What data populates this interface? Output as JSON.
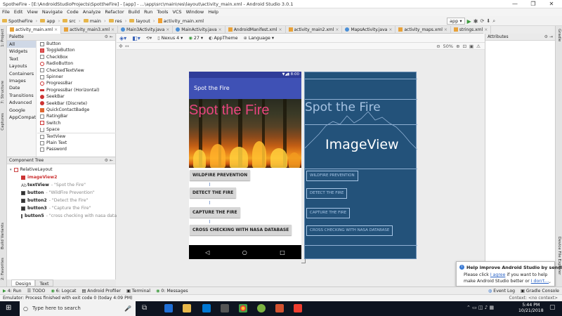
{
  "window": {
    "title": "SpotheFire - [E:\\AndroidStudioProjects\\SpottheFire] - [app] - ...\\app\\src\\main\\res\\layout\\activity_main.xml - Android Studio 3.0.1",
    "min_glyph": "—",
    "max_glyph": "❐",
    "close_glyph": "✕"
  },
  "menu": [
    "File",
    "Edit",
    "View",
    "Navigate",
    "Code",
    "Analyze",
    "Refactor",
    "Build",
    "Run",
    "Tools",
    "VCS",
    "Window",
    "Help"
  ],
  "breadcrumbs": [
    "SpotheFire",
    "app",
    "src",
    "main",
    "res",
    "layout",
    "activity_main.xml"
  ],
  "run_config": "app",
  "tabs": [
    {
      "label": "activity_main.xml",
      "type": "xml",
      "active": true
    },
    {
      "label": "activity_main3.xml",
      "type": "xml"
    },
    {
      "label": "Main3Activity.java",
      "type": "java"
    },
    {
      "label": "MainActivity.java",
      "type": "java"
    },
    {
      "label": "AndroidManifest.xml",
      "type": "xml"
    },
    {
      "label": "activity_main2.xml",
      "type": "xml"
    },
    {
      "label": "MapsActivity.java",
      "type": "java"
    },
    {
      "label": "activity_maps.xml",
      "type": "xml"
    },
    {
      "label": "strings.xml",
      "type": "xml"
    }
  ],
  "left_strip": [
    "1: Project",
    "7: Structure",
    "Captures",
    "Build Variants",
    "2: Favorites"
  ],
  "right_strip": [
    "Gradle",
    "Device File Explorer"
  ],
  "palette": {
    "title": "Palette",
    "categories": [
      "All",
      "Widgets",
      "Text",
      "Layouts",
      "Containers",
      "Images",
      "Date",
      "Transitions",
      "Advanced",
      "Google",
      "AppCompat"
    ],
    "selected_category": "All",
    "widgets": [
      "Button",
      "ToggleButton",
      "CheckBox",
      "RadioButton",
      "CheckedTextView",
      "Spinner",
      "ProgressBar",
      "ProgressBar (Horizontal)",
      "SeekBar",
      "SeekBar (Discrete)",
      "QuickContactBadge",
      "RatingBar",
      "Switch",
      "Space",
      "TextView",
      "Plain Text",
      "Password"
    ]
  },
  "component_tree": {
    "title": "Component Tree",
    "root": "RelativeLayout",
    "items": [
      {
        "id": "imageView2",
        "hint": "",
        "error": true
      },
      {
        "id": "textView",
        "hint": "- \"Spot the Fire\""
      },
      {
        "id": "button",
        "hint": "- \"WildFire Prevention\""
      },
      {
        "id": "button2",
        "hint": "- \"Detect the Fire\""
      },
      {
        "id": "button3",
        "hint": "- \"Capture the Fire\""
      },
      {
        "id": "button5",
        "hint": "- \"cross checking with nasa database\""
      }
    ]
  },
  "design_tabs": [
    "Design",
    "Text"
  ],
  "design_toolbar": {
    "device": "Nexus 4",
    "api": "27",
    "theme": "AppTheme",
    "language": "Language",
    "zoom": "50%"
  },
  "attributes_title": "Attributes",
  "preview": {
    "status_time": "8:00",
    "app_title": "Spot the Fire",
    "overlay_text": "Spot the Fire",
    "buttons": [
      "WILDFIRE PREVENTION",
      "DETECT THE FIRE",
      "CAPTURE THE FIRE",
      "CROSS CHECKING WITH NASA DATABASE"
    ],
    "nav_glyphs": [
      "◁",
      "○",
      "□"
    ]
  },
  "blueprint": {
    "text": "Spot the Fire",
    "image_label": "ImageView",
    "buttons": [
      "WILDFIRE PREVENTION",
      "DETECT THE FIRE",
      "CAPTURE THE FIRE",
      "CROSS CHECKING WITH NASA DATABASE"
    ]
  },
  "notification": {
    "title": "Help improve Android Studio by sendi",
    "body_prefix": "Please click ",
    "link_agree": "I agree",
    "body_mid": " if you want to help make Android Studio better or ",
    "link_dont": "I don't..."
  },
  "tool_windows": [
    "4: Run",
    "TODO",
    "6: Logcat",
    "Android Profiler",
    "Terminal",
    "0: Messages"
  ],
  "tool_windows_right": [
    "Event Log",
    "Gradle Console"
  ],
  "status": {
    "message": "Emulator: Process finished with exit code 0 (today 4:09 PM)",
    "right": "Context: <no context>"
  },
  "taskbar": {
    "search_placeholder": "Type here to search",
    "time": "5:44 PM",
    "date": "10/21/2018"
  },
  "colors": {
    "accent": "#3f51b5",
    "status_dark": "#2f3c99",
    "blueprint": "#23527a",
    "overlay_pink": "#e8457e"
  }
}
